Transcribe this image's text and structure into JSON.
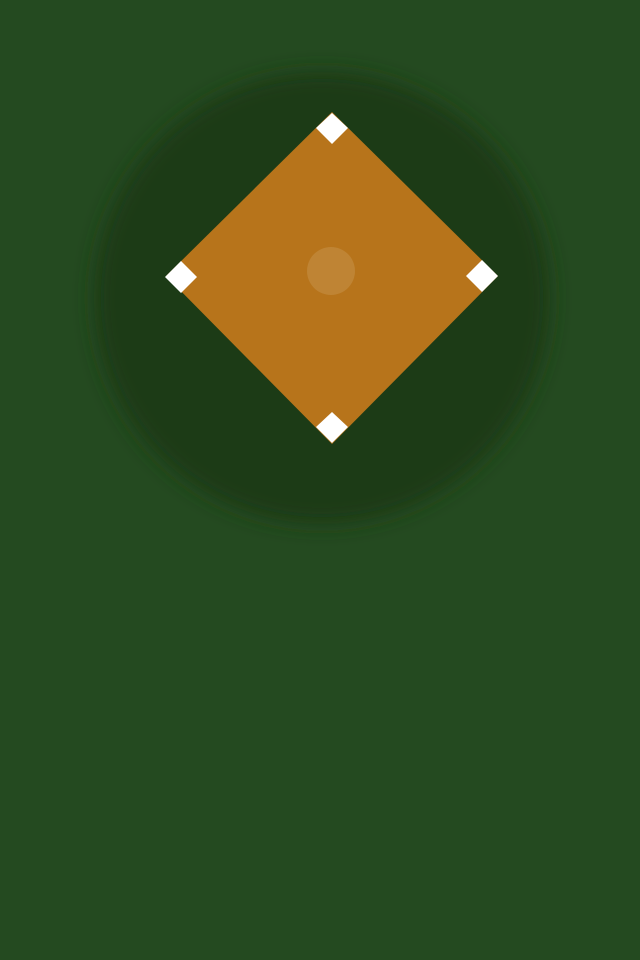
{
  "scene": {
    "type": "baseball-infield",
    "view": "top-down",
    "colors": {
      "outfield_grass": "#244a20",
      "infield_shadow": "#1a3a16",
      "infield_dirt": "#b7741b",
      "pitchers_mound": "#bf8434",
      "base": "#ffffff"
    },
    "bases": [
      "second-base",
      "first-base",
      "home-plate",
      "third-base"
    ]
  }
}
